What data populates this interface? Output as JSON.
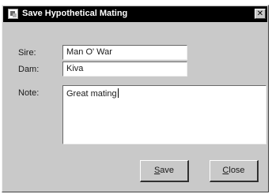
{
  "window": {
    "title": "Save Hypothetical Mating",
    "close_glyph": "✕"
  },
  "form": {
    "sire_label": "Sire:",
    "sire_value": "Man O' War",
    "dam_label": "Dam:",
    "dam_value": "Kiva",
    "note_label": "Note:",
    "note_value": "Great mating"
  },
  "buttons": {
    "save_label": "Save",
    "save_mnemonic": "S",
    "close_label": "Close",
    "close_mnemonic": "C"
  }
}
